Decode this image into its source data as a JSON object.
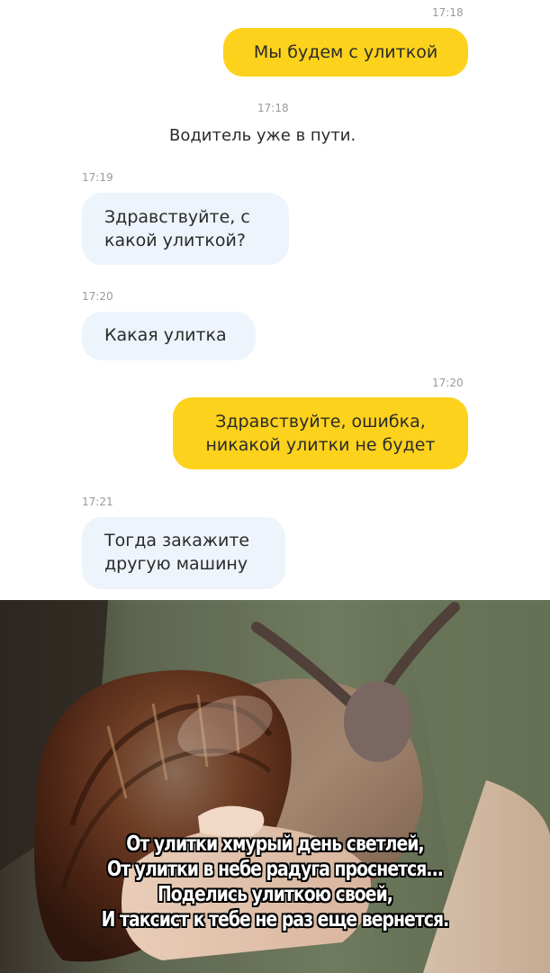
{
  "chat": {
    "messages": [
      {
        "time": "17:18",
        "lines": [
          "Мы будем с улиткой"
        ]
      },
      {
        "time": "17:18",
        "text": "Водитель уже в пути."
      },
      {
        "time": "17:19",
        "lines": [
          "Здравствуйте, с",
          "какой улиткой?"
        ]
      },
      {
        "time": "17:20",
        "lines": [
          "Какая улитка"
        ]
      },
      {
        "time": "17:20",
        "lines": [
          "Здравствуйте, ошибка,",
          "никакой улитки не будет"
        ]
      },
      {
        "time": "17:21",
        "lines": [
          "Тогда закажите",
          "другую машину"
        ]
      }
    ]
  },
  "caption": {
    "lines": [
      "От улитки хмурый день светлей,",
      "От улитки в небе радуга проснется...",
      "Поделись улиткою своей,",
      "И таксист к тебе не раз еще вернется."
    ]
  },
  "colors": {
    "outgoing_bubble": "#fcd21c",
    "incoming_bubble": "#eef4fb"
  }
}
